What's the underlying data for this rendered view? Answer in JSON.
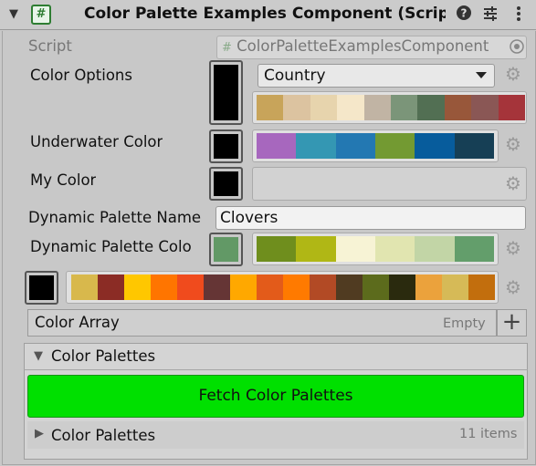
{
  "header": {
    "foldout_icon": "triangle-down",
    "script_icon": "#",
    "title": "Color Palette Examples Component (Script)",
    "icons": [
      "help-icon",
      "preset-sliders-icon",
      "kebab-menu-icon"
    ]
  },
  "script_field": {
    "label": "Script",
    "value": "ColorPaletteExamplesComponent",
    "prefix_icon": "#"
  },
  "color_options": {
    "label": "Color Options",
    "swatch_color": "#000000",
    "dropdown_value": "Country",
    "palette": [
      "#c8a45a",
      "#dcc3a0",
      "#e7d4ad",
      "#f5e7c9",
      "#c1b4a4",
      "#7b9579",
      "#526f53",
      "#98573a",
      "#8a5755",
      "#a5343a"
    ]
  },
  "underwater_color": {
    "label": "Underwater Color",
    "swatch_color": "#000000",
    "palette": [
      "#a767be",
      "#3497b3",
      "#2378b2",
      "#739a32",
      "#075c9c",
      "#163f55"
    ]
  },
  "my_color": {
    "label": "My Color",
    "swatch_color": "#000000"
  },
  "dynamic_palette_name": {
    "label": "Dynamic Palette Name",
    "value": "Clovers"
  },
  "dynamic_palette_color": {
    "label": "Dynamic Palette Colo",
    "swatch_color": "#629966",
    "palette": [
      "#6f8e1d",
      "#b0b715",
      "#f7f3d5",
      "#e1e5b0",
      "#c2d5a6",
      "#639e6b"
    ]
  },
  "unnamed_color": {
    "swatch_color": "#000000",
    "palette": [
      "#d8b84c",
      "#8b2c25",
      "#ffc700",
      "#ff7500",
      "#f04b1d",
      "#653535",
      "#ffa800",
      "#e35b1a",
      "#ff7a00",
      "#b24a25",
      "#503b21",
      "#5c6b1c",
      "#2a2a0e",
      "#eba23c",
      "#d6ba57",
      "#c26e0d"
    ]
  },
  "color_array": {
    "label": "Color Array",
    "status": "Empty",
    "add_icon": "plus-icon"
  },
  "color_palettes_group": {
    "label": "Color Palettes",
    "fetch_button": "Fetch Color Palettes",
    "fetch_button_color": "#00e000",
    "list_label": "Color Palettes",
    "list_count": "11 items"
  }
}
